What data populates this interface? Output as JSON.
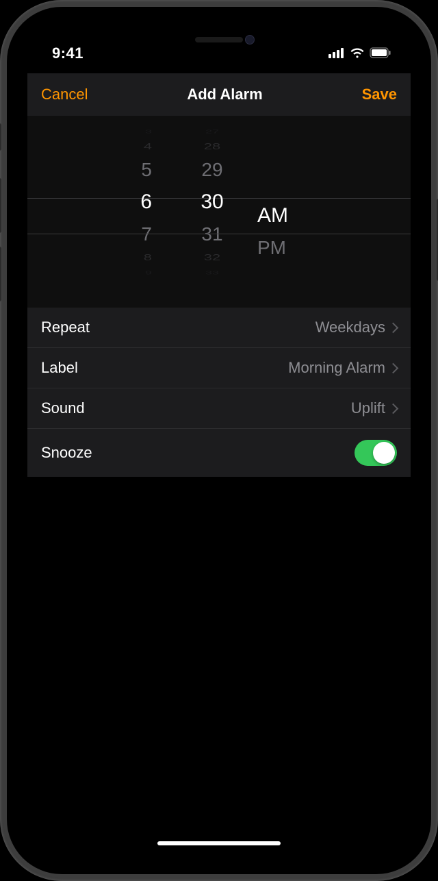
{
  "status": {
    "time": "9:41"
  },
  "nav": {
    "cancel": "Cancel",
    "title": "Add Alarm",
    "save": "Save"
  },
  "picker": {
    "hours_above_far2": "3",
    "hours_above_far": "4",
    "hours_above": "5",
    "hours_selected": "6",
    "hours_below": "7",
    "hours_below_far": "8",
    "hours_below_far2": "9",
    "mins_above_far2": "27",
    "mins_above_far": "28",
    "mins_above": "29",
    "mins_selected": "30",
    "mins_below": "31",
    "mins_below_far": "32",
    "mins_below_far2": "33",
    "ampm_selected": "AM",
    "ampm_below": "PM"
  },
  "rows": {
    "repeat_label": "Repeat",
    "repeat_value": "Weekdays",
    "label_label": "Label",
    "label_value": "Morning Alarm",
    "sound_label": "Sound",
    "sound_value": "Uplift",
    "snooze_label": "Snooze"
  },
  "snooze_on": true,
  "colors": {
    "accent": "#ff9500",
    "switch_on": "#34c759"
  }
}
